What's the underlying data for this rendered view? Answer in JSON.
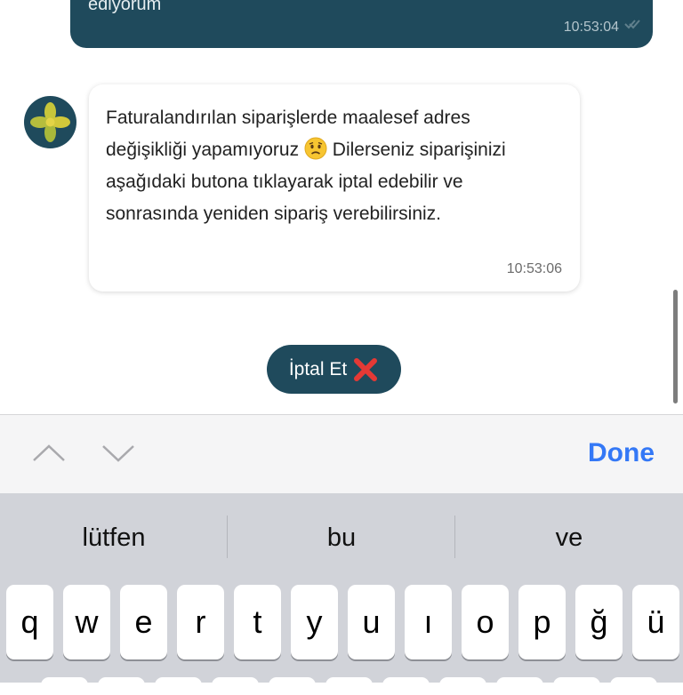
{
  "chat": {
    "outgoing": {
      "text": "ediyorum",
      "time": "10:53:04",
      "status_icon": "double-check-icon"
    },
    "incoming": {
      "avatar_icon": "flower-logo-icon",
      "text_before_emoji": "Faturalandırılan siparişlerde maalesef adres değişikliği yapamıyoruz ",
      "emoji": "worried-face-emoji",
      "text_after_emoji": " Dilerseniz siparişinizi aşağıdaki butona tıklayarak iptal edebilir ve sonrasında yeniden sipariş verebilirsiniz.",
      "time": "10:53:06"
    },
    "action_button": {
      "label": "İptal Et",
      "icon": "red-cross-icon"
    }
  },
  "toolbar": {
    "prev_icon": "chevron-up-icon",
    "next_icon": "chevron-down-icon",
    "done_label": "Done"
  },
  "keyboard": {
    "suggestions": [
      "lütfen",
      "bu",
      "ve"
    ],
    "rows": [
      [
        "q",
        "w",
        "e",
        "r",
        "t",
        "y",
        "u",
        "ı",
        "o",
        "p",
        "ğ",
        "ü"
      ]
    ]
  },
  "colors": {
    "brand_dark": "#1f4a5c",
    "done_blue": "#3478f6",
    "keyboard_bg": "#d1d3d9",
    "cancel_red": "#e53935"
  }
}
